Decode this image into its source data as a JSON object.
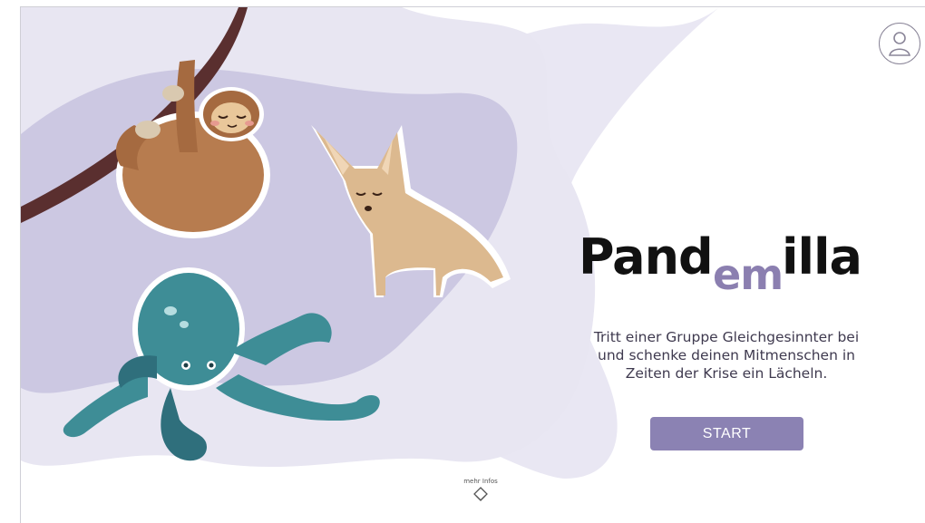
{
  "header": {
    "profile_icon": "user-profile-icon"
  },
  "brand": {
    "name_part1": "Pand",
    "name_part2": "em",
    "name_part3": "illa",
    "accent_color": "#8b7fb0",
    "text_color": "#111111"
  },
  "hero": {
    "tagline": "Tritt einer Gruppe Gleichgesinnter bei und schenke deinen Mitmenschen in Zeiten der Krise ein Lächeln.",
    "illustrations": [
      "sloth",
      "fennec-fox",
      "octopus",
      "branch"
    ]
  },
  "actions": {
    "start_label": "START",
    "start_color": "#8b82b3"
  },
  "footer": {
    "more_info_label": "mehr Infos",
    "more_info_icon": "diamond-chevron-down-icon"
  },
  "colors": {
    "blob_light": "#e8e6f2",
    "blob_mid": "#cbc7e2"
  }
}
